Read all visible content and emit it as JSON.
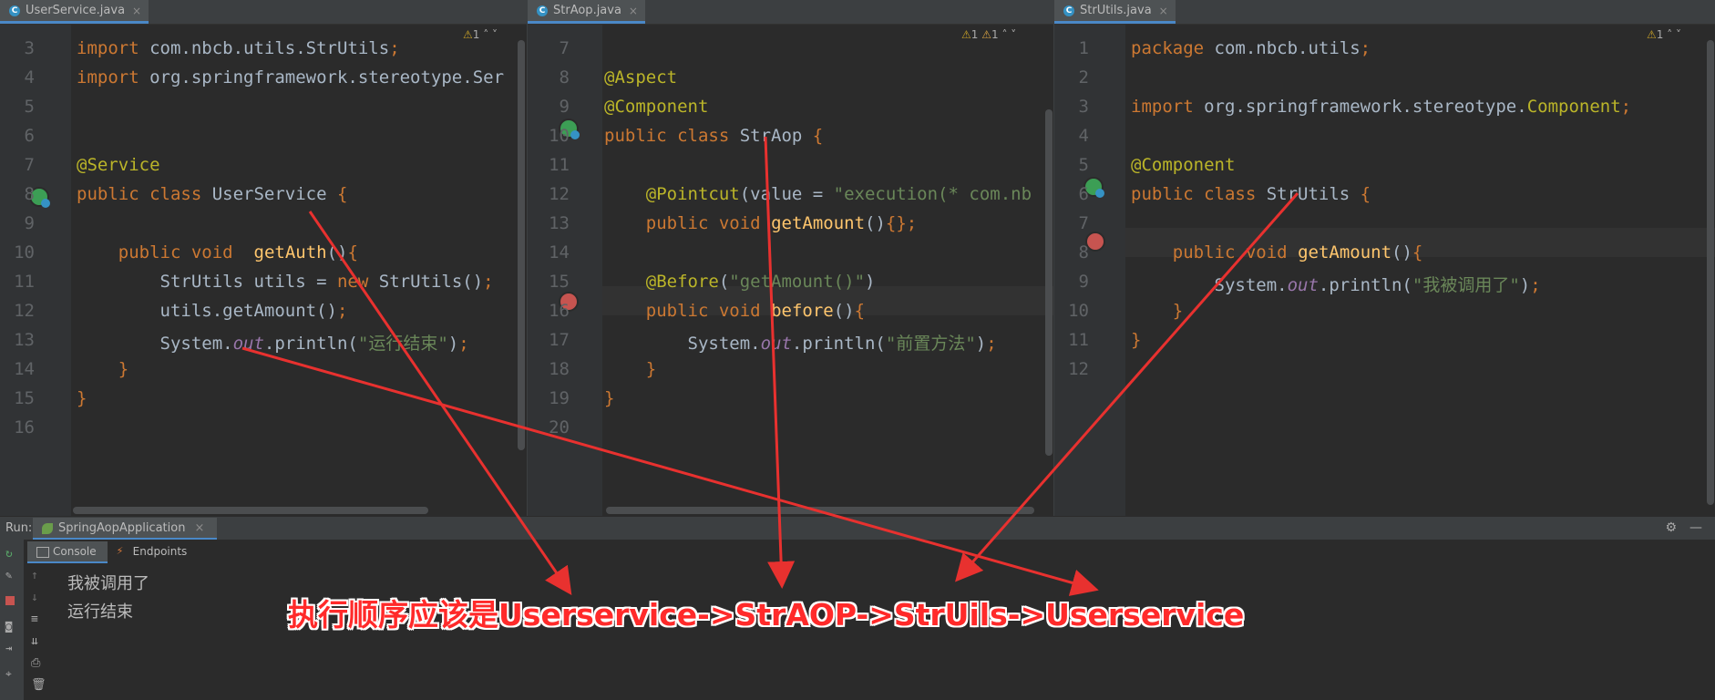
{
  "panes": [
    {
      "tab": "UserService.java",
      "warning_count": "1",
      "lines": [
        {
          "n": "3",
          "html": "<span class='kw'>import</span> com.nbcb.utils.StrUtils<span class='kw'>;</span>"
        },
        {
          "n": "4",
          "html": "<span class='kw'>import</span> org.springframework.stereotype.Ser"
        },
        {
          "n": "5",
          "html": ""
        },
        {
          "n": "6",
          "html": ""
        },
        {
          "n": "7",
          "html": "<span class='an'>@Service</span>"
        },
        {
          "n": "8",
          "html": "<span class='kw'>public class</span> UserService <span class='br'>{</span>"
        },
        {
          "n": "9",
          "html": ""
        },
        {
          "n": "10",
          "html": "    <span class='kw'>public void</span>  <span class='fn'>getAuth</span>()<span class='br'>{</span>"
        },
        {
          "n": "11",
          "html": "        StrUtils utils = <span class='kw'>new</span> StrUtils()<span class='kw'>;</span>"
        },
        {
          "n": "12",
          "html": "        utils.getAmount()<span class='kw'>;</span>"
        },
        {
          "n": "13",
          "html": "        System.<span class='ital'>out</span>.println(<span class='str'>\"运行结束\"</span>)<span class='kw'>;</span>"
        },
        {
          "n": "14",
          "html": "    <span class='br'>}</span>"
        },
        {
          "n": "15",
          "html": "<span class='br'>}</span>"
        },
        {
          "n": "16",
          "html": ""
        }
      ]
    },
    {
      "tab": "StrAop.java",
      "warning_count": "1",
      "error_count": "1",
      "lines": [
        {
          "n": "7",
          "html": ""
        },
        {
          "n": "8",
          "html": "<span class='an'>@Aspect</span>"
        },
        {
          "n": "9",
          "html": "<span class='an'>@Component</span>"
        },
        {
          "n": "10",
          "html": "<span class='kw'>public class</span> StrAop <span class='br'>{</span>"
        },
        {
          "n": "11",
          "html": ""
        },
        {
          "n": "12",
          "html": "    <span class='an'>@Pointcut</span>(value = <span class='str'>\"execution(* com.nb</span>"
        },
        {
          "n": "13",
          "html": "    <span class='kw'>public void</span> <span class='fn'>getAmount</span>()<span class='br'>{}</span><span class='kw'>;</span>"
        },
        {
          "n": "14",
          "html": ""
        },
        {
          "n": "15",
          "html": "    <span class='an'>@Before</span>(<span class='str'>\"getAmount()\"</span>)"
        },
        {
          "n": "16",
          "html": "    <span class='kw'>public void</span> <span class='fn'>before</span>()<span class='br'>{</span>"
        },
        {
          "n": "17",
          "html": "        System.<span class='ital'>out</span>.println(<span class='str'>\"前置方法\"</span>)<span class='kw'>;</span>"
        },
        {
          "n": "18",
          "html": "    <span class='br'>}</span>"
        },
        {
          "n": "19",
          "html": "<span class='br'>}</span>"
        },
        {
          "n": "20",
          "html": ""
        }
      ]
    },
    {
      "tab": "StrUtils.java",
      "warning_count": "1",
      "lines": [
        {
          "n": "1",
          "html": "<span class='kw'>package</span> com.nbcb.utils<span class='kw'>;</span>"
        },
        {
          "n": "2",
          "html": ""
        },
        {
          "n": "3",
          "html": "<span class='kw'>import</span> org.springframework.stereotype.<span class='an'>Component</span><span class='kw'>;</span>"
        },
        {
          "n": "4",
          "html": ""
        },
        {
          "n": "5",
          "html": "<span class='an'>@Component</span>"
        },
        {
          "n": "6",
          "html": "<span class='kw'>public class</span> StrUtils <span class='br'>{</span>"
        },
        {
          "n": "7",
          "html": ""
        },
        {
          "n": "8",
          "html": "    <span class='kw'>public void</span> <span class='fn'>getAmount</span>()<span class='br'>{</span>"
        },
        {
          "n": "9",
          "html": "        System.<span class='ital'>out</span>.println(<span class='str'>\"我被调用了\"</span>)<span class='kw'>;</span>"
        },
        {
          "n": "10",
          "html": "    <span class='br'>}</span>"
        },
        {
          "n": "11",
          "html": "<span class='br'>}</span>"
        },
        {
          "n": "12",
          "html": ""
        }
      ]
    }
  ],
  "run": {
    "label": "Run:",
    "app": "SpringAopApplication",
    "tabs": [
      "Console",
      "Endpoints"
    ],
    "output": [
      "我被调用了",
      "运行结束"
    ]
  },
  "annotation": {
    "text": "执行顺序应该是Userservice->StrAOP->StrUils->Userservice",
    "color": "#ff2a2a"
  },
  "colors": {
    "editor_bg": "#2b2b2b",
    "keyword": "#cc7832",
    "annotation": "#bbb529",
    "string": "#6a8759",
    "method": "#ffc66d"
  }
}
